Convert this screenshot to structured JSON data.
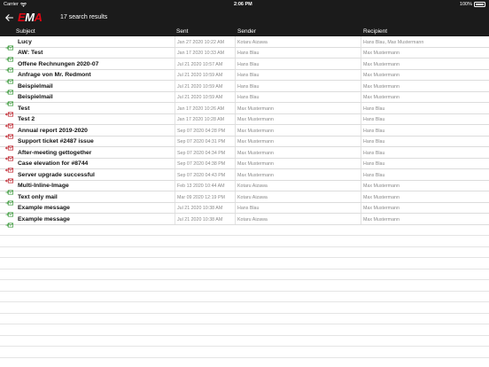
{
  "status_bar": {
    "carrier": "Carrier",
    "time": "2:06 PM",
    "battery": "100%"
  },
  "header": {
    "logo_part1": "E",
    "logo_part2": "M",
    "logo_part3": "A",
    "result_count": "17 search results"
  },
  "columns": {
    "subject": "Subject",
    "sent": "Sent",
    "sender": "Sender",
    "recipient": "Recipient"
  },
  "colors": {
    "incoming_icon": "#3a9a3a",
    "outgoing_icon": "#c0202a",
    "header_bg": "#1b1b1b",
    "logo_red": "#e30613"
  },
  "rows": [
    {
      "direction": "incoming",
      "subject": "Lucy",
      "sent": "Jan 27 2020 10:22 AM",
      "sender": "Kotaru Aizawa",
      "recipient": "Hans Blau, Max Mustermann"
    },
    {
      "direction": "incoming",
      "subject": "AW: Test",
      "sent": "Jan 17 2020 10:33 AM",
      "sender": "Hans Blau",
      "recipient": "Max Mustermann"
    },
    {
      "direction": "incoming",
      "subject": "Offene Rechnungen 2020-07",
      "sent": "Jul 21 2020 10:57 AM",
      "sender": "Hans Blau",
      "recipient": "Max Mustermann"
    },
    {
      "direction": "incoming",
      "subject": "Anfrage von Mr. Redmont",
      "sent": "Jul 21 2020 10:59 AM",
      "sender": "Hans Blau",
      "recipient": "Max Mustermann"
    },
    {
      "direction": "incoming",
      "subject": "Beispielmail",
      "sent": "Jul 21 2020 10:59 AM",
      "sender": "Hans Blau",
      "recipient": "Max Mustermann"
    },
    {
      "direction": "incoming",
      "subject": "Beispielmail",
      "sent": "Jul 21 2020 10:59 AM",
      "sender": "Hans Blau",
      "recipient": "Max Mustermann"
    },
    {
      "direction": "outgoing",
      "subject": "Test",
      "sent": "Jan 17 2020 10:26 AM",
      "sender": "Max Mustermann",
      "recipient": "Hans Blau"
    },
    {
      "direction": "outgoing",
      "subject": "Test 2",
      "sent": "Jan 17 2020 10:28 AM",
      "sender": "Max Mustermann",
      "recipient": "Hans Blau"
    },
    {
      "direction": "outgoing",
      "subject": "Annual report 2019-2020",
      "sent": "Sep 07 2020 04:28 PM",
      "sender": "Max Mustermann",
      "recipient": "Hans Blau"
    },
    {
      "direction": "outgoing",
      "subject": "Support ticket #2487 issue",
      "sent": "Sep 07 2020 04:31 PM",
      "sender": "Max Mustermann",
      "recipient": "Hans Blau"
    },
    {
      "direction": "outgoing",
      "subject": "After-meeting gettogether",
      "sent": "Sep 07 2020 04:34 PM",
      "sender": "Max Mustermann",
      "recipient": "Hans Blau"
    },
    {
      "direction": "outgoing",
      "subject": "Case elevation for #8744",
      "sent": "Sep 07 2020 04:38 PM",
      "sender": "Max Mustermann",
      "recipient": "Hans Blau"
    },
    {
      "direction": "outgoing",
      "subject": "Server upgrade successful",
      "sent": "Sep 07 2020 04:43 PM",
      "sender": "Max Mustermann",
      "recipient": "Hans Blau"
    },
    {
      "direction": "incoming",
      "subject": "Multi-Inline-Image",
      "sent": "Feb 13 2020 10:44 AM",
      "sender": "Kotaru Aizawa",
      "recipient": "Max Mustermann"
    },
    {
      "direction": "incoming",
      "subject": "Text only mail",
      "sent": "Mar 09 2020 12:19 PM",
      "sender": "Kotaru Aizawa",
      "recipient": "Max Mustermann"
    },
    {
      "direction": "incoming",
      "subject": "Example message",
      "sent": "Jul 21 2020 10:38 AM",
      "sender": "Hans Blau",
      "recipient": "Max Mustermann"
    },
    {
      "direction": "incoming",
      "subject": "Example message",
      "sent": "Jul 21 2020 10:38 AM",
      "sender": "Kotaru Aizawa",
      "recipient": "Max Mustermann"
    }
  ]
}
